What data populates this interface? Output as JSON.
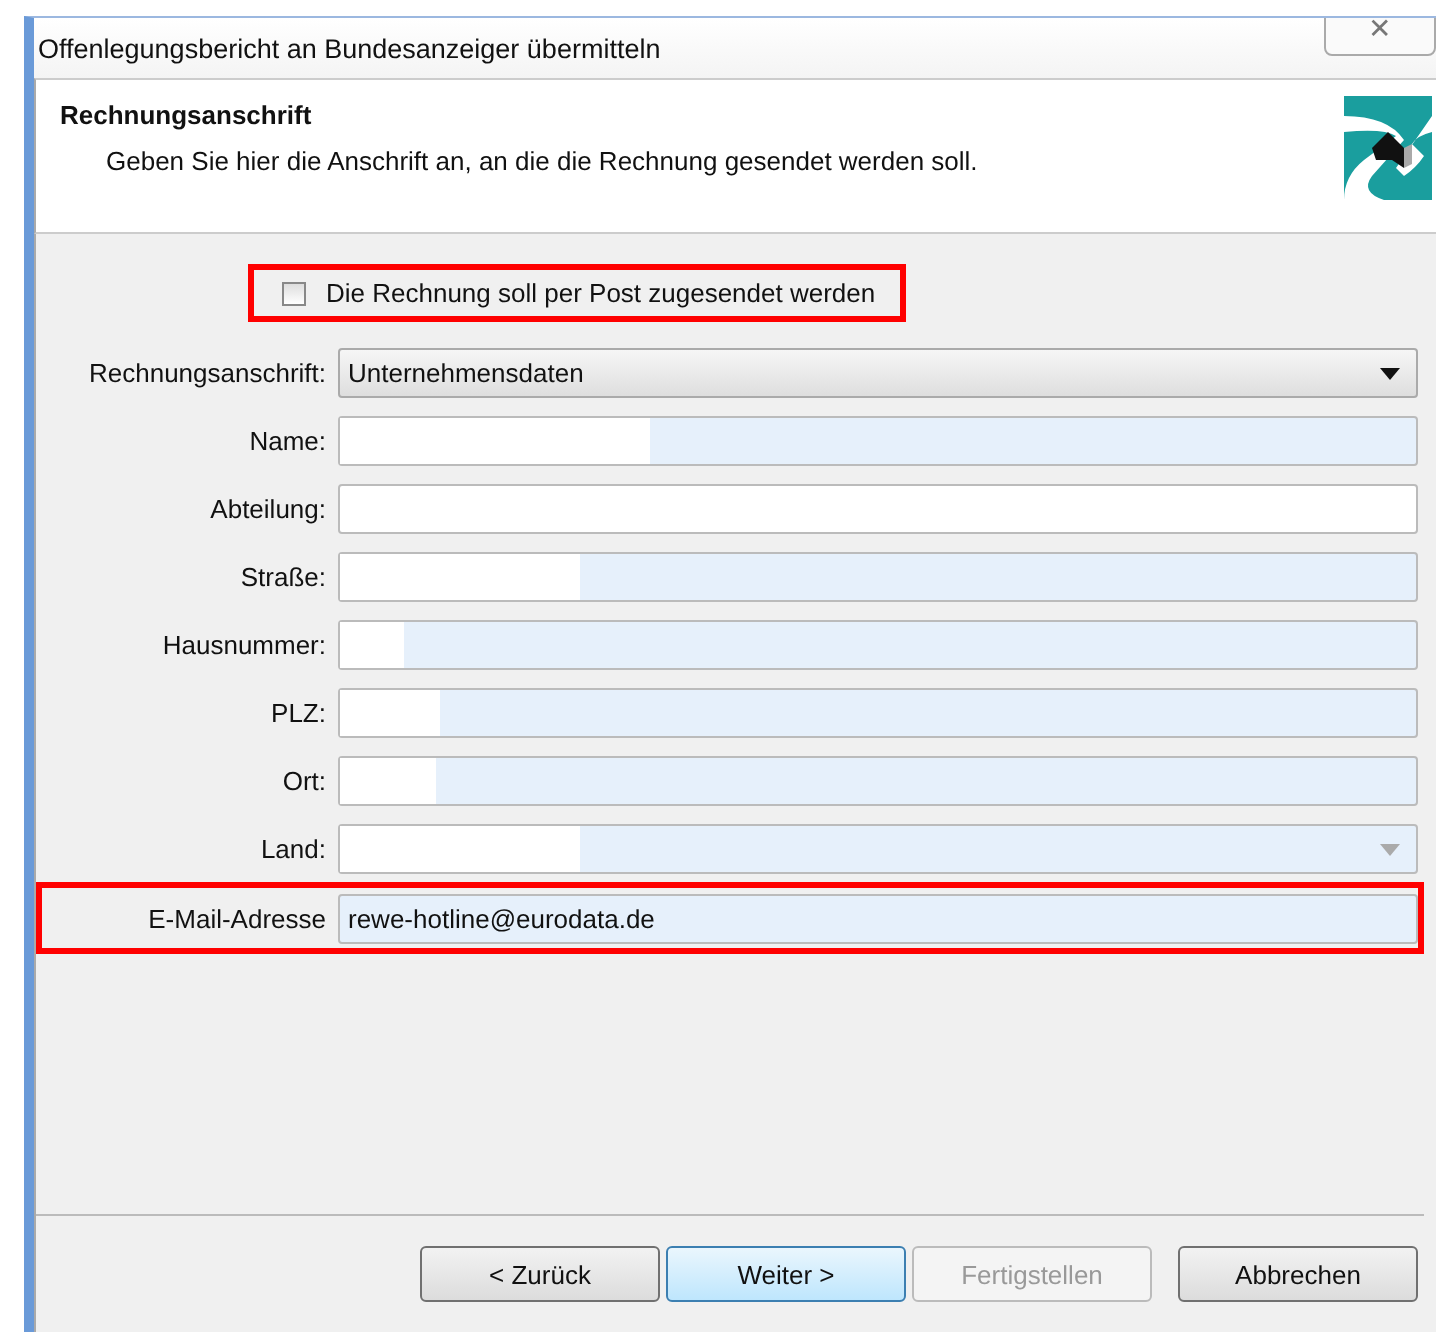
{
  "window": {
    "title": "Offenlegungsbericht an Bundesanzeiger übermitteln",
    "close": "✕"
  },
  "header": {
    "title": "Rechnungsanschrift",
    "subtitle": "Geben Sie hier die Anschrift an, an die die Rechnung gesendet werden soll."
  },
  "post_checkbox": {
    "label": "Die Rechnung soll per Post zugesendet werden",
    "checked": false,
    "highlighted": true
  },
  "fields": [
    {
      "label": "Rechnungsanschrift:",
      "kind": "select",
      "value": "Unternehmensdaten",
      "editable": true,
      "redacted": false,
      "highlighted": false
    },
    {
      "label": "Name:",
      "kind": "text",
      "editable": false,
      "redacted": true,
      "highlighted": false
    },
    {
      "label": "Abteilung:",
      "kind": "text",
      "editable": true,
      "redacted": false,
      "highlighted": false
    },
    {
      "label": "Straße:",
      "kind": "text",
      "editable": false,
      "redacted": true,
      "highlighted": false
    },
    {
      "label": "Hausnummer:",
      "kind": "text",
      "editable": false,
      "redacted": true,
      "highlighted": false
    },
    {
      "label": "PLZ:",
      "kind": "text",
      "editable": false,
      "redacted": true,
      "highlighted": false
    },
    {
      "label": "Ort:",
      "kind": "text",
      "editable": false,
      "redacted": true,
      "highlighted": false
    },
    {
      "label": "Land:",
      "kind": "select",
      "editable": false,
      "redacted": true,
      "highlighted": false
    },
    {
      "label": "E-Mail-Adresse",
      "kind": "text",
      "value": "rewe-hotline@eurodata.de",
      "editable": false,
      "redacted": false,
      "highlighted": true
    }
  ],
  "buttons": [
    {
      "label": "< Zurück",
      "disabled": false,
      "default": false
    },
    {
      "label": "Weiter >",
      "disabled": false,
      "default": true
    },
    {
      "label": "Fertigstellen",
      "disabled": true,
      "default": false
    },
    {
      "label": "Abbrechen",
      "disabled": false,
      "default": false
    }
  ]
}
